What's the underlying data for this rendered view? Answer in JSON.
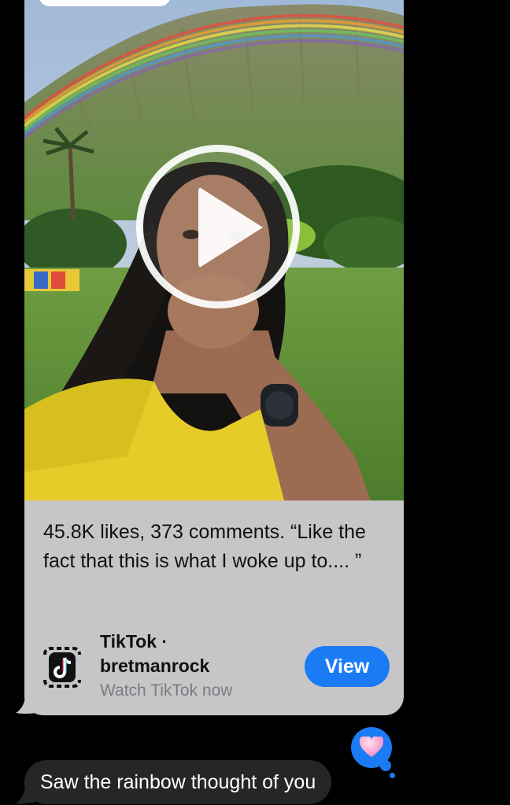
{
  "video": {
    "play_icon": "play-icon"
  },
  "link_preview": {
    "caption": "45.8K likes, 373 comments. “Like the fact that this is what I woke up to.... ”",
    "app_name": "TikTok ·",
    "username": "bretmanrock",
    "call_to_action": "Watch TikTok now",
    "view_button": "View",
    "app_icon": "tiktok-icon"
  },
  "reaction": {
    "icon": "heart-icon",
    "color": "#1b7bf5"
  },
  "message": {
    "text": "Saw the rainbow thought of you"
  },
  "colors": {
    "accent": "#1b7bf5",
    "preview_bg": "#c6c6c8",
    "message_bg": "#262628"
  }
}
